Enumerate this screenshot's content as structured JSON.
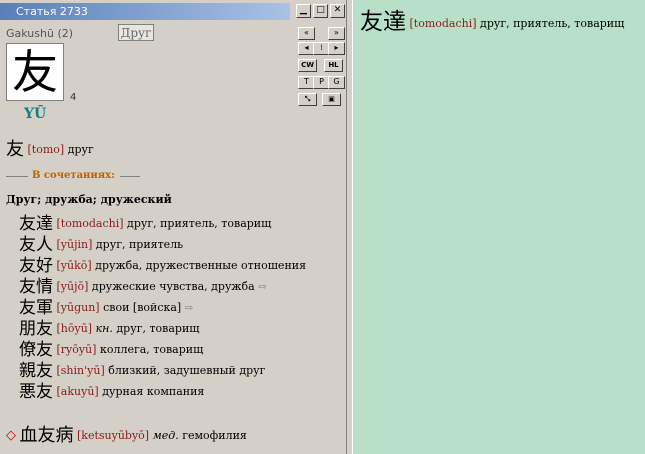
{
  "window": {
    "title": "Статья 2733"
  },
  "window_buttons": [
    {
      "name": "minimize",
      "glyph": "▁"
    },
    {
      "name": "maximize",
      "glyph": "□"
    },
    {
      "name": "close",
      "glyph": "✕"
    }
  ],
  "toolbar": [
    [
      "«",
      "»"
    ],
    [
      "◂",
      "⁞",
      "▸"
    ],
    [
      "CW",
      "HL"
    ],
    [
      "T",
      "P",
      "G"
    ],
    [
      "⤡",
      "▣"
    ]
  ],
  "kanji": {
    "source": "Gakushū (2)",
    "meaning": "Друг",
    "character": "友",
    "strokes": "4",
    "onyomi": "YŪ"
  },
  "main_word": {
    "kanji": "友",
    "reading": "[tomo]",
    "translation": "друг"
  },
  "compounds_label": "В сочетаниях:",
  "group_header": "Друг;  дружба;  дружеский",
  "compounds": [
    {
      "kanji": "友達",
      "reading": "[tomodachi]",
      "note": "",
      "translation": "друг, приятель, товарищ",
      "arrow": ""
    },
    {
      "kanji": "友人",
      "reading": "[yūjin]",
      "note": "",
      "translation": "друг, приятель",
      "arrow": ""
    },
    {
      "kanji": "友好",
      "reading": "[yūkō]",
      "note": "",
      "translation": "дружба, дружественные отношения",
      "arrow": ""
    },
    {
      "kanji": "友情",
      "reading": "[yūjō]",
      "note": "",
      "translation": "дружеские чувства, дружба",
      "arrow": "⇨"
    },
    {
      "kanji": "友軍",
      "reading": "[yūgun]",
      "note": "",
      "translation": "свои [войска]",
      "arrow": "⇨"
    },
    {
      "kanji": "朋友",
      "reading": "[hōyū]",
      "note": "кн.",
      "translation": "друг, товарищ",
      "arrow": ""
    },
    {
      "kanji": "僚友",
      "reading": "[ryōyū]",
      "note": "",
      "translation": "коллега, товарищ",
      "arrow": ""
    },
    {
      "kanji": "親友",
      "reading": "[shin'yū]",
      "note": "",
      "translation": "близкий, задушевный друг",
      "arrow": ""
    },
    {
      "kanji": "悪友",
      "reading": "[akuyū]",
      "note": "",
      "translation": "дурная компания",
      "arrow": ""
    }
  ],
  "extra": {
    "marker": "◇",
    "kanji": "血友病",
    "reading": "[ketsuyūbyō]",
    "note": "мед.",
    "translation": "гемофилия"
  },
  "right_pane": {
    "kanji": "友達",
    "reading": "[tomodachi]",
    "translation": "друг, приятель, товарищ"
  },
  "colors": {
    "reading": "#8b1a1a",
    "onyomi": "#0f8080",
    "section_label": "#c06000",
    "right_bg": "#b8e0c8"
  }
}
